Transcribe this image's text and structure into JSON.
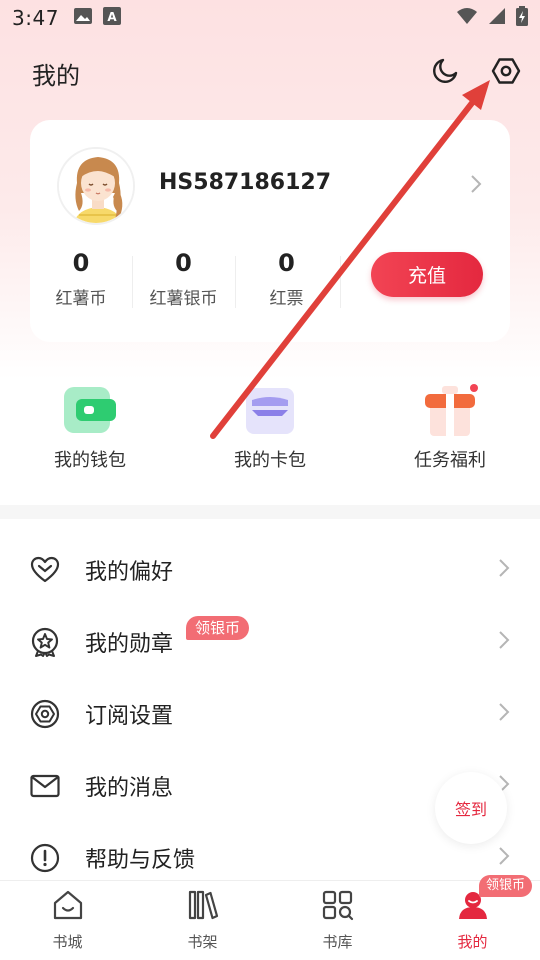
{
  "status_bar": {
    "time": "3:47",
    "icons": [
      "image-icon",
      "font-icon"
    ],
    "right_icons": [
      "wifi-icon",
      "signal-icon",
      "battery-icon"
    ]
  },
  "header": {
    "title": "我的",
    "icons": [
      "moon-icon",
      "settings-icon"
    ]
  },
  "profile": {
    "username": "HS587186127",
    "stats": [
      {
        "value": "0",
        "label": "红薯币"
      },
      {
        "value": "0",
        "label": "红薯银币"
      },
      {
        "value": "0",
        "label": "红票"
      }
    ],
    "recharge_label": "充值"
  },
  "quick_actions": [
    {
      "label": "我的钱包",
      "icon": "wallet-icon"
    },
    {
      "label": "我的卡包",
      "icon": "card-icon"
    },
    {
      "label": "任务福利",
      "icon": "gift-icon"
    }
  ],
  "menu": [
    {
      "label": "我的偏好",
      "icon": "heart-icon"
    },
    {
      "label": "我的勋章",
      "icon": "medal-icon",
      "badge": "领银币"
    },
    {
      "label": "订阅设置",
      "icon": "gear-icon"
    },
    {
      "label": "我的消息",
      "icon": "mail-icon"
    },
    {
      "label": "帮助与反馈",
      "icon": "alert-icon"
    }
  ],
  "sign_in_label": "签到",
  "bottom_nav": [
    {
      "label": "书城",
      "icon": "home-icon"
    },
    {
      "label": "书架",
      "icon": "bookshelf-icon"
    },
    {
      "label": "书库",
      "icon": "library-icon"
    },
    {
      "label": "我的",
      "icon": "profile-icon",
      "active": true,
      "badge": "领银币"
    }
  ],
  "colors": {
    "accent": "#e4283f",
    "badge": "#f26d74",
    "annotation_arrow": "#e0403a"
  }
}
